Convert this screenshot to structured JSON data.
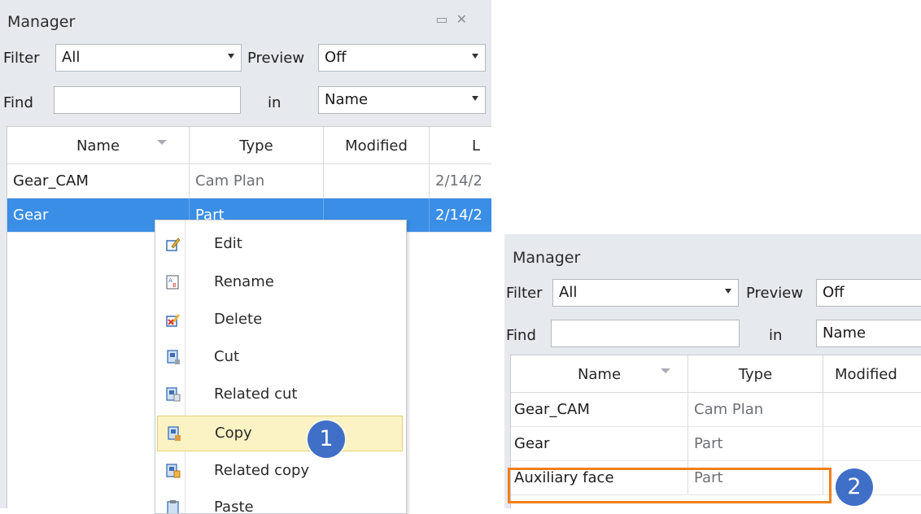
{
  "panel1": {
    "title": "Manager",
    "filter_label": "Filter",
    "filter_value": "All",
    "preview_label": "Preview",
    "preview_value": "Off",
    "find_label": "Find",
    "find_value": "",
    "in_label": "in",
    "in_value": "Name",
    "columns": [
      "Name",
      "Type",
      "Modified",
      "L"
    ],
    "rows": [
      {
        "name": "Gear_CAM",
        "type": "Cam Plan",
        "modified": "",
        "last": "2/14/2"
      },
      {
        "name": "Gear",
        "type": "Part",
        "modified": "",
        "last": "2/14/2"
      }
    ]
  },
  "context_menu": {
    "items": [
      {
        "label": "Edit",
        "icon": "edit-icon"
      },
      {
        "label": "Rename",
        "icon": "rename-icon"
      },
      {
        "label": "Delete",
        "icon": "delete-icon"
      },
      {
        "label": "Cut",
        "icon": "cut-icon"
      },
      {
        "label": "Related cut",
        "icon": "related-cut-icon"
      },
      {
        "label": "Copy",
        "icon": "copy-icon"
      },
      {
        "label": "Related copy",
        "icon": "related-copy-icon"
      },
      {
        "label": "Paste",
        "icon": "paste-icon"
      }
    ]
  },
  "panel2": {
    "title": "Manager",
    "filter_label": "Filter",
    "filter_value": "All",
    "preview_label": "Preview",
    "preview_value": "Off",
    "find_label": "Find",
    "find_value": "",
    "in_label": "in",
    "in_value": "Name",
    "columns": [
      "Name",
      "Type",
      "Modified"
    ],
    "rows": [
      {
        "name": "Gear_CAM",
        "type": "Cam Plan"
      },
      {
        "name": "Gear",
        "type": "Part"
      },
      {
        "name": "Auxiliary face",
        "type": "Part"
      }
    ]
  },
  "callouts": {
    "step1": "1",
    "step2": "2"
  },
  "colors": {
    "selection": "#3a8ee6",
    "highlight_outline": "#f0801a",
    "badge": "#3f6fc6",
    "menu_highlight": "#fcf3c5"
  }
}
